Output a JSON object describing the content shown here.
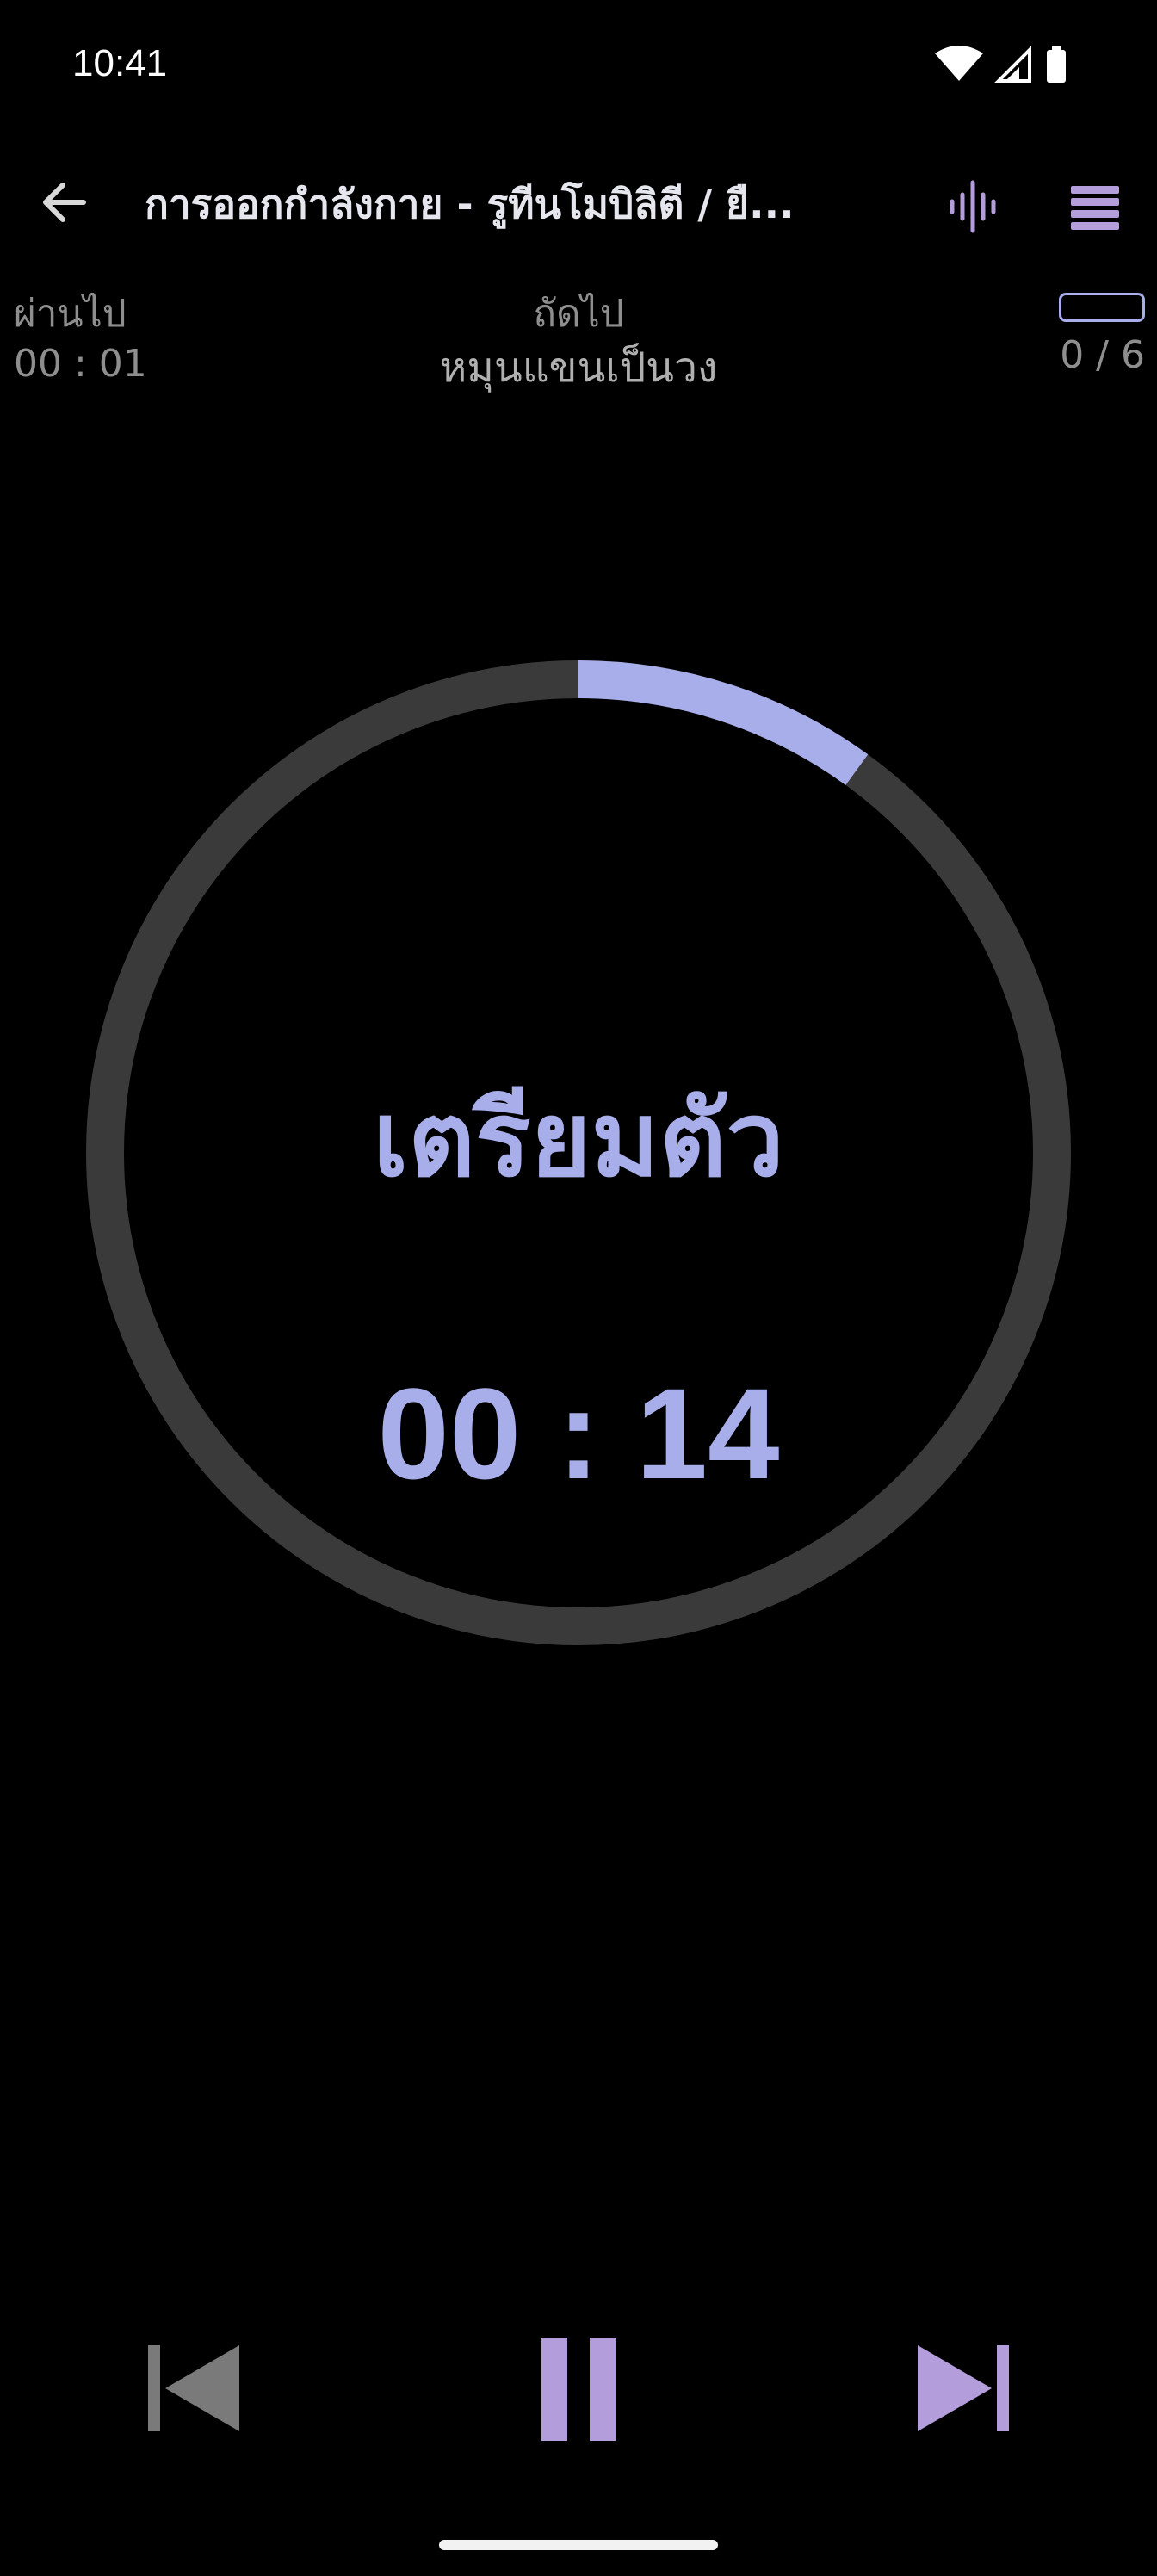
{
  "status_bar": {
    "time": "10:41",
    "icons": [
      "wifi-icon",
      "cellular-signal-icon",
      "battery-icon"
    ]
  },
  "toolbar": {
    "title": "การออกกำลังกาย - รูทีนโมบิลิตี / ยื...",
    "back_icon": "arrow-back-icon",
    "voice_icon": "voice-waveform-icon",
    "menu_icon": "menu-icon"
  },
  "info": {
    "elapsed_label": "ผ่านไป",
    "elapsed_value": "00 : 01",
    "next_label": "ถัดไป",
    "next_value": "หมุนแขนเป็นวง",
    "counter": "0 / 6",
    "counter_progress": 0
  },
  "timer": {
    "phase": "เตรียมตัว",
    "remaining": "00 : 14",
    "progress_fraction": 0.1
  },
  "controls": {
    "prev_icon": "skip-previous-icon",
    "pause_icon": "pause-icon",
    "next_icon": "skip-next-icon"
  },
  "colors": {
    "accent": "#a8aeea",
    "purple": "#b39ddb",
    "ring_track": "#3a3a3a",
    "muted_text": "#8e8e8e",
    "disabled_icon": "#7a7a7a"
  }
}
